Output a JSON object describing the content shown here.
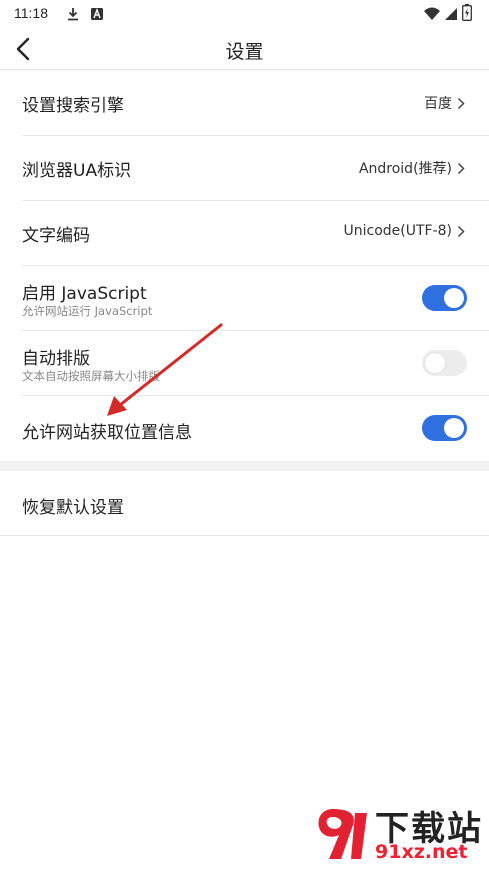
{
  "status_bar": {
    "time": "11:18",
    "icons": [
      "download-icon",
      "notification-a-icon",
      "wifi-icon",
      "signal-icon",
      "battery-icon"
    ]
  },
  "header": {
    "title": "设置",
    "back_icon": "chevron-left-icon"
  },
  "settings": [
    {
      "label": "设置搜索引擎",
      "value": "百度"
    },
    {
      "label": "浏览器UA标识",
      "value": "Android(推荐)"
    },
    {
      "label": "文字编码",
      "value": "Unicode(UTF-8)"
    },
    {
      "label": "启用 JavaScript",
      "sub": "允许网站运行 JavaScript",
      "enabled": true
    },
    {
      "label": "自动排版",
      "sub": "文本自动按照屏幕大小排版",
      "enabled": false
    },
    {
      "label": "允许网站获取位置信息",
      "enabled": true
    }
  ],
  "reset": {
    "label": "恢复默认设置"
  },
  "watermark": {
    "text": "下载站",
    "url": "91xz.net"
  },
  "colors": {
    "toggle_on": "#2f6fe0",
    "toggle_off": "#ececec",
    "annotation_arrow": "#d42a2a",
    "watermark_red": "#e22233"
  }
}
